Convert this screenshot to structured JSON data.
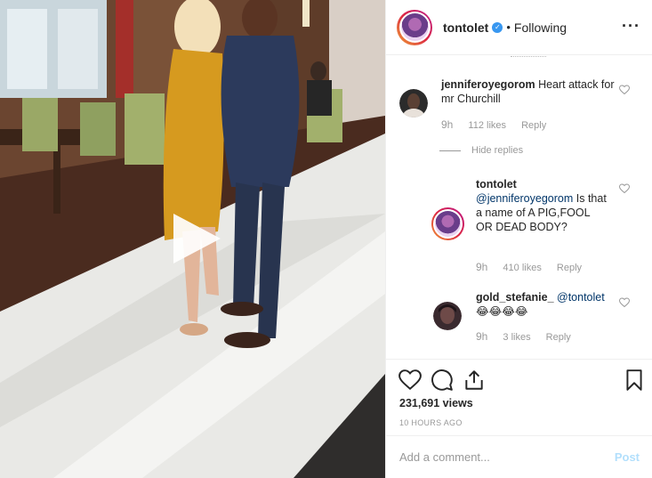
{
  "header": {
    "username": "tontolet",
    "separator": "•",
    "follow_status": "Following",
    "more_icon": "more-options-icon"
  },
  "comments": [
    {
      "username": "jenniferoyegorom",
      "text": "Heart attack for mr Churchill",
      "time": "9h",
      "likes": "112 likes",
      "reply_label": "Reply"
    }
  ],
  "hide_replies_label": "Hide replies",
  "replies": [
    {
      "username": "tontolet",
      "mention": "@jenniferoyegorom",
      "text": "Is that a name of A PIG,FOOL OR DEAD BODY?",
      "time": "9h",
      "likes": "410 likes",
      "reply_label": "Reply"
    },
    {
      "username": "gold_stefanie_",
      "mention": "@tontolet",
      "text": "😂😂😂😂",
      "time": "9h",
      "likes": "3 likes",
      "reply_label": "Reply"
    }
  ],
  "stats": {
    "views": "231,691 views",
    "time_ago": "10 HOURS AGO"
  },
  "add_comment": {
    "placeholder": "Add a comment...",
    "post_label": "Post"
  },
  "colors": {
    "accent": "#3897f0",
    "post_disabled": "#b2dffc",
    "muted_text": "#999999"
  }
}
